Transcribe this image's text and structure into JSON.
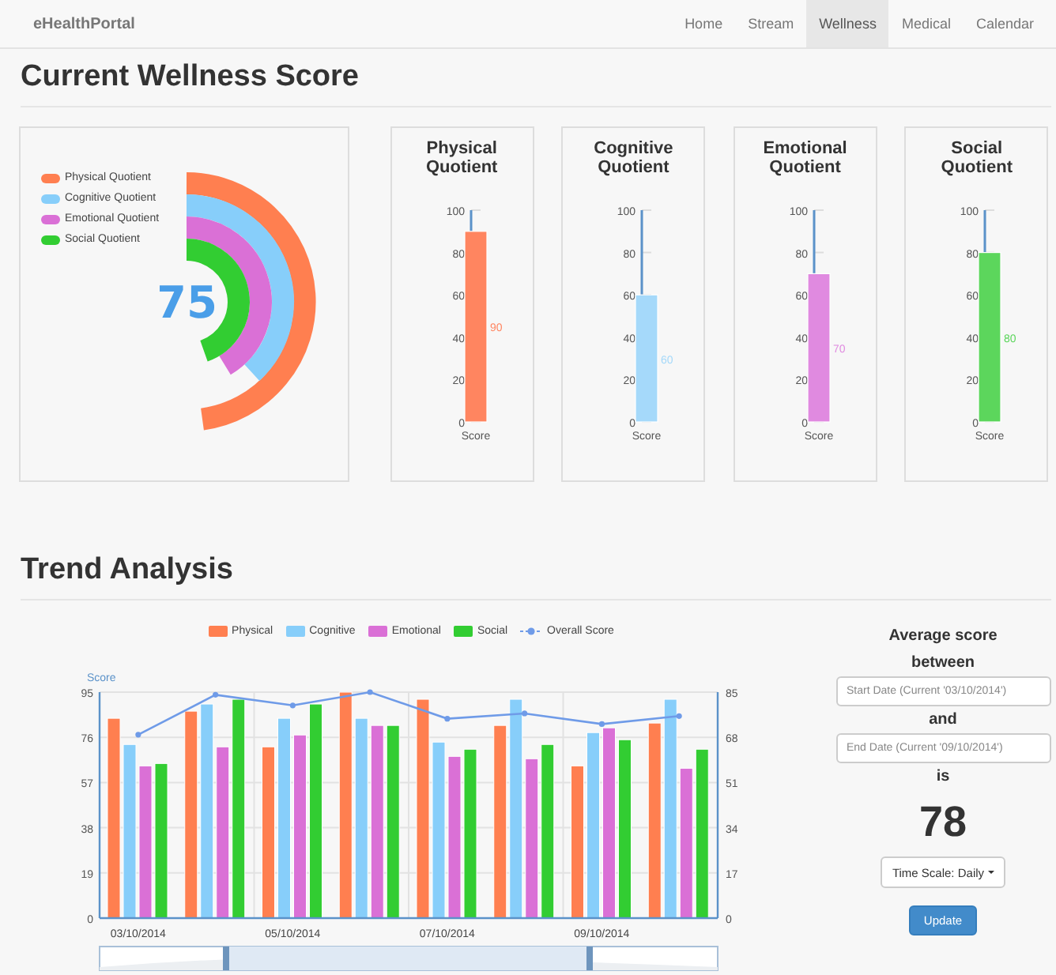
{
  "nav": {
    "brand": "eHealthPortal",
    "items": [
      {
        "label": "Home",
        "selected": false
      },
      {
        "label": "Stream",
        "selected": false
      },
      {
        "label": "Wellness",
        "selected": true
      },
      {
        "label": "Medical",
        "selected": false
      },
      {
        "label": "Calendar",
        "selected": false
      }
    ]
  },
  "current": {
    "title": "Current Wellness Score",
    "radial": {
      "score": "75",
      "items": [
        {
          "label": "Physical Quotient",
          "color": "#ff7f50"
        },
        {
          "label": "Cognitive Quotient",
          "color": "#87cefa"
        },
        {
          "label": "Emotional Quotient",
          "color": "#da70d6"
        },
        {
          "label": "Social Quotient",
          "color": "#32cd32"
        }
      ]
    },
    "quotients": [
      {
        "title": "Physical Quotient",
        "chart_data": {
          "type": "bar",
          "categories": [
            "Score"
          ],
          "ylim": [
            0,
            100
          ],
          "yticks": [
            0,
            20,
            40,
            60,
            80,
            100
          ],
          "data_labels": true,
          "series": [
            {
              "color": "#ff8560",
              "values": [
                90
              ]
            }
          ]
        }
      },
      {
        "title": "Cognitive Quotient",
        "chart_data": {
          "type": "bar",
          "categories": [
            "Score"
          ],
          "ylim": [
            0,
            100
          ],
          "yticks": [
            0,
            20,
            40,
            60,
            80,
            100
          ],
          "data_labels": true,
          "series": [
            {
              "color": "#a5d9fa",
              "values": [
                60
              ]
            }
          ]
        }
      },
      {
        "title": "Emotional Quotient",
        "chart_data": {
          "type": "bar",
          "categories": [
            "Score"
          ],
          "ylim": [
            0,
            100
          ],
          "yticks": [
            0,
            20,
            40,
            60,
            80,
            100
          ],
          "data_labels": true,
          "series": [
            {
              "color": "#e08ae0",
              "values": [
                70
              ]
            }
          ]
        }
      },
      {
        "title": "Social Quotient",
        "chart_data": {
          "type": "bar",
          "categories": [
            "Score"
          ],
          "ylim": [
            0,
            100
          ],
          "yticks": [
            0,
            20,
            40,
            60,
            80,
            100
          ],
          "data_labels": true,
          "series": [
            {
              "color": "#5cd65c",
              "values": [
                80
              ]
            }
          ]
        }
      }
    ]
  },
  "trend": {
    "title": "Trend Analysis",
    "chart_data": {
      "type": "bar",
      "ylabel": "Score",
      "categories": [
        "03/10/2014",
        null,
        "05/10/2014",
        null,
        "07/10/2014",
        null,
        "09/10/2014",
        null
      ],
      "ylim": [
        0,
        95
      ],
      "yticks": [
        0,
        19,
        38,
        57,
        76,
        95
      ],
      "grid": true,
      "series": [
        {
          "name": "Physical",
          "color": "#ff7f50",
          "values": [
            84,
            87,
            72,
            95,
            92,
            81,
            64,
            82
          ]
        },
        {
          "name": "Cognitive",
          "color": "#87cefa",
          "values": [
            73,
            90,
            84,
            84,
            74,
            92,
            78,
            92
          ]
        },
        {
          "name": "Emotional",
          "color": "#da70d6",
          "values": [
            64,
            72,
            77,
            81,
            68,
            67,
            80,
            63
          ]
        },
        {
          "name": "Social",
          "color": "#32cd32",
          "values": [
            65,
            92,
            90,
            81,
            71,
            73,
            75,
            71
          ]
        }
      ]
    },
    "overall": {
      "chart_data": {
        "type": "line",
        "ylim": [
          0,
          85
        ],
        "yticks": [
          0,
          17,
          34,
          51,
          68,
          85
        ],
        "series": [
          {
            "name": "Overall Score",
            "color": "#6f9be8",
            "marker": true,
            "values": [
              69,
              84,
              80,
              85,
              75,
              77,
              73,
              76
            ]
          }
        ]
      }
    },
    "average": {
      "heading": "Average score",
      "between": "between",
      "start_placeholder": "Start Date (Current '03/10/2014')",
      "joiner": "and",
      "end_placeholder": "End Date (Current '09/10/2014')",
      "suffix": "is",
      "score": "78",
      "timescale": "Time Scale: Daily",
      "button": "Update"
    }
  }
}
